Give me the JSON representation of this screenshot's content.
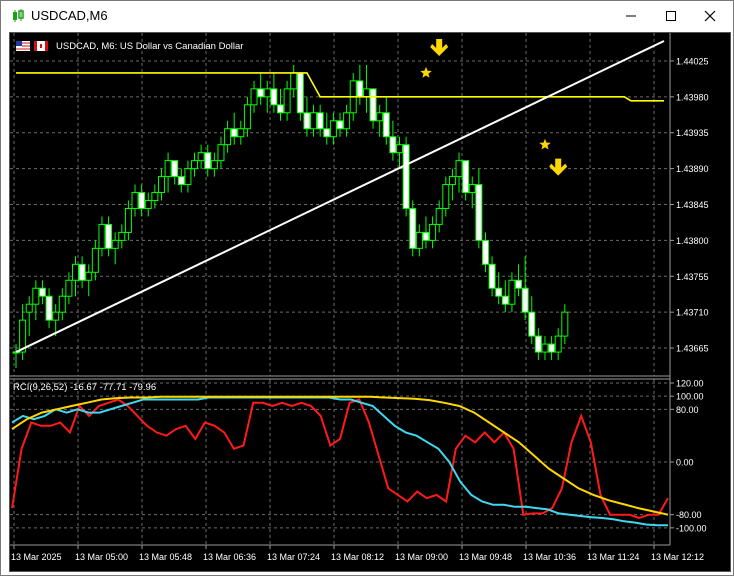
{
  "window": {
    "title": "USDCAD,M6",
    "minimize_icon": "minimize-icon",
    "maximize_icon": "maximize-icon",
    "close_icon": "close-icon"
  },
  "chart": {
    "header_text": "USDCAD, M6:  US Dollar vs Canadian Dollar",
    "indicator_text": "RCI(9,26,52) -16.67 -77.71 -79.96",
    "colors": {
      "background": "#000000",
      "grid": "#6b6b6b",
      "candle": "#00ff00",
      "candle_body_up": "#000000",
      "candle_body_down": "#ffffff",
      "ma_line": "#ffff00",
      "trend_line": "#ffffff",
      "marker": "#ffd700",
      "rci_fast": "#ff1a1a",
      "rci_mid": "#40d8f0",
      "rci_slow": "#ffd700",
      "axis_text": "#ffffff"
    },
    "price_ticks": [
      "1.44025",
      "1.43980",
      "1.43935",
      "1.43890",
      "1.43845",
      "1.43800",
      "1.43755",
      "1.43710",
      "1.43665"
    ],
    "rci_ticks": [
      "120.00",
      "100.00",
      "80.00",
      "0.00",
      "-80.00",
      "-100.00"
    ],
    "time_ticks": [
      "13 Mar 2025",
      "13 Mar 05:00",
      "13 Mar 05:48",
      "13 Mar 06:36",
      "13 Mar 07:24",
      "13 Mar 08:12",
      "13 Mar 09:00",
      "13 Mar 09:48",
      "13 Mar 10:36",
      "13 Mar 11:24",
      "13 Mar 12:12"
    ]
  },
  "chart_data": {
    "type": "candlestick",
    "symbol": "USDCAD",
    "timeframe": "M6",
    "price_range": [
      1.4364,
      1.4405
    ],
    "candles": [
      [
        1.4366,
        1.4367,
        1.4364,
        1.4366
      ],
      [
        1.4366,
        1.4372,
        1.4365,
        1.437
      ],
      [
        1.4371,
        1.4373,
        1.4368,
        1.4372
      ],
      [
        1.4372,
        1.4375,
        1.437,
        1.4374
      ],
      [
        1.4374,
        1.4375,
        1.4372,
        1.4373
      ],
      [
        1.4373,
        1.4374,
        1.4369,
        1.437
      ],
      [
        1.437,
        1.4372,
        1.4368,
        1.4371
      ],
      [
        1.4371,
        1.4374,
        1.437,
        1.4373
      ],
      [
        1.4373,
        1.4376,
        1.4372,
        1.4375
      ],
      [
        1.4375,
        1.4378,
        1.4373,
        1.4377
      ],
      [
        1.4377,
        1.4378,
        1.4374,
        1.4375
      ],
      [
        1.4375,
        1.4377,
        1.4373,
        1.4376
      ],
      [
        1.4376,
        1.438,
        1.4375,
        1.4379
      ],
      [
        1.4379,
        1.4383,
        1.4378,
        1.4382
      ],
      [
        1.4382,
        1.4383,
        1.4378,
        1.4379
      ],
      [
        1.4379,
        1.4381,
        1.4377,
        1.438
      ],
      [
        1.438,
        1.4382,
        1.4379,
        1.4381
      ],
      [
        1.4381,
        1.4385,
        1.438,
        1.4384
      ],
      [
        1.4384,
        1.4387,
        1.4383,
        1.4386
      ],
      [
        1.4386,
        1.4387,
        1.4383,
        1.4384
      ],
      [
        1.4384,
        1.4386,
        1.4383,
        1.4385
      ],
      [
        1.4385,
        1.4387,
        1.4384,
        1.4386
      ],
      [
        1.4386,
        1.4389,
        1.4385,
        1.4388
      ],
      [
        1.4388,
        1.4391,
        1.4386,
        1.439
      ],
      [
        1.439,
        1.439,
        1.4387,
        1.4388
      ],
      [
        1.4388,
        1.4389,
        1.4386,
        1.4387
      ],
      [
        1.4387,
        1.439,
        1.4386,
        1.4389
      ],
      [
        1.4389,
        1.4391,
        1.4388,
        1.439
      ],
      [
        1.439,
        1.4392,
        1.4389,
        1.4391
      ],
      [
        1.4391,
        1.4392,
        1.4388,
        1.4389
      ],
      [
        1.4389,
        1.4391,
        1.4388,
        1.439
      ],
      [
        1.439,
        1.4393,
        1.4389,
        1.4392
      ],
      [
        1.4392,
        1.4395,
        1.4391,
        1.4394
      ],
      [
        1.4394,
        1.4396,
        1.4392,
        1.4393
      ],
      [
        1.4393,
        1.4395,
        1.4392,
        1.4394
      ],
      [
        1.4394,
        1.4398,
        1.4393,
        1.4397
      ],
      [
        1.4397,
        1.44,
        1.4396,
        1.4399
      ],
      [
        1.4399,
        1.4401,
        1.4397,
        1.4398
      ],
      [
        1.4398,
        1.44,
        1.4396,
        1.4399
      ],
      [
        1.4399,
        1.4401,
        1.4396,
        1.4397
      ],
      [
        1.4397,
        1.4399,
        1.4395,
        1.4396
      ],
      [
        1.4396,
        1.44,
        1.4395,
        1.4399
      ],
      [
        1.4399,
        1.4402,
        1.4398,
        1.4401
      ],
      [
        1.4401,
        1.4401,
        1.4395,
        1.4396
      ],
      [
        1.4396,
        1.4398,
        1.4393,
        1.4394
      ],
      [
        1.4394,
        1.4397,
        1.4393,
        1.4396
      ],
      [
        1.4396,
        1.4397,
        1.4393,
        1.4394
      ],
      [
        1.4394,
        1.4396,
        1.4392,
        1.4393
      ],
      [
        1.4393,
        1.4396,
        1.4392,
        1.4395
      ],
      [
        1.4395,
        1.4396,
        1.4393,
        1.4394
      ],
      [
        1.4394,
        1.4397,
        1.4393,
        1.4396
      ],
      [
        1.4396,
        1.4401,
        1.4395,
        1.44
      ],
      [
        1.44,
        1.4402,
        1.4397,
        1.4398
      ],
      [
        1.4398,
        1.4402,
        1.4396,
        1.4399
      ],
      [
        1.4399,
        1.4399,
        1.4394,
        1.4395
      ],
      [
        1.4395,
        1.4397,
        1.4393,
        1.4396
      ],
      [
        1.4396,
        1.4398,
        1.4392,
        1.4393
      ],
      [
        1.4393,
        1.4395,
        1.439,
        1.4391
      ],
      [
        1.4391,
        1.4393,
        1.4389,
        1.4392
      ],
      [
        1.4392,
        1.4393,
        1.4383,
        1.4384
      ],
      [
        1.4384,
        1.4385,
        1.4378,
        1.4379
      ],
      [
        1.4379,
        1.4382,
        1.4378,
        1.4381
      ],
      [
        1.4381,
        1.4383,
        1.4379,
        1.438
      ],
      [
        1.438,
        1.4383,
        1.4379,
        1.4382
      ],
      [
        1.4382,
        1.4385,
        1.4381,
        1.4384
      ],
      [
        1.4384,
        1.4388,
        1.4383,
        1.4387
      ],
      [
        1.4387,
        1.4389,
        1.4385,
        1.4388
      ],
      [
        1.4388,
        1.4391,
        1.4386,
        1.439
      ],
      [
        1.439,
        1.439,
        1.4385,
        1.4386
      ],
      [
        1.4386,
        1.4388,
        1.4384,
        1.4387
      ],
      [
        1.4387,
        1.4389,
        1.4379,
        1.438
      ],
      [
        1.438,
        1.4381,
        1.4376,
        1.4377
      ],
      [
        1.4377,
        1.4378,
        1.4373,
        1.4374
      ],
      [
        1.4374,
        1.4376,
        1.4372,
        1.4373
      ],
      [
        1.4373,
        1.4375,
        1.4371,
        1.4372
      ],
      [
        1.4372,
        1.4376,
        1.4371,
        1.4375
      ],
      [
        1.4375,
        1.4377,
        1.4373,
        1.4374
      ],
      [
        1.4374,
        1.4378,
        1.437,
        1.4371
      ],
      [
        1.4371,
        1.4373,
        1.4367,
        1.4368
      ],
      [
        1.4368,
        1.4369,
        1.4365,
        1.4366
      ],
      [
        1.4366,
        1.4368,
        1.4365,
        1.4367
      ],
      [
        1.4367,
        1.4368,
        1.4365,
        1.4366
      ],
      [
        1.4366,
        1.4369,
        1.4365,
        1.4368
      ],
      [
        1.4368,
        1.4372,
        1.4367,
        1.4371
      ]
    ],
    "ma_line": [
      [
        0,
        1.4401
      ],
      [
        44,
        1.4401
      ],
      [
        46,
        1.4398
      ],
      [
        92,
        1.4398
      ],
      [
        93,
        1.43975
      ],
      [
        98,
        1.43975
      ]
    ],
    "trend_line": [
      [
        0,
        1.4366
      ],
      [
        98,
        1.4405
      ]
    ],
    "markers": [
      {
        "type": "star",
        "bar": 62,
        "price": 1.4401
      },
      {
        "type": "arrow-down",
        "bar": 64,
        "price": 1.4404
      },
      {
        "type": "star",
        "bar": 80,
        "price": 1.4392
      },
      {
        "type": "arrow-down",
        "bar": 82,
        "price": 1.4389
      }
    ],
    "rci": {
      "name": "RCI(9,26,52)",
      "ylim": [
        -120,
        120
      ],
      "fast": [
        -70,
        20,
        60,
        55,
        55,
        60,
        45,
        85,
        70,
        85,
        90,
        95,
        85,
        70,
        55,
        45,
        40,
        50,
        55,
        35,
        60,
        55,
        45,
        20,
        25,
        90,
        90,
        85,
        90,
        85,
        90,
        85,
        70,
        25,
        35,
        90,
        95,
        60,
        10,
        -40,
        -50,
        -60,
        -45,
        -55,
        -50,
        -60,
        20,
        40,
        30,
        45,
        30,
        45,
        20,
        -80,
        -78,
        -78,
        -70,
        -40,
        30,
        70,
        30,
        -50,
        -80,
        -80,
        -80,
        -85,
        -80,
        -80,
        -55
      ],
      "mid": [
        60,
        70,
        65,
        70,
        80,
        75,
        80,
        75,
        75,
        80,
        85,
        90,
        95,
        95,
        95,
        95,
        95,
        95,
        98,
        98,
        98,
        98,
        98,
        98,
        98,
        98,
        98,
        98,
        98,
        98,
        95,
        95,
        90,
        85,
        70,
        55,
        45,
        40,
        30,
        20,
        0,
        -30,
        -50,
        -60,
        -65,
        -65,
        -68,
        -68,
        -70,
        -72,
        -78,
        -80,
        -82,
        -84,
        -85,
        -87,
        -90,
        -92,
        -95,
        -96,
        -96
      ],
      "slow": [
        50,
        65,
        75,
        80,
        85,
        90,
        95,
        97,
        98,
        98,
        99,
        99,
        99,
        99,
        99,
        99,
        99,
        99,
        99,
        99,
        99,
        99,
        99,
        99,
        99,
        98,
        97,
        96,
        94,
        90,
        85,
        75,
        60,
        45,
        30,
        10,
        -10,
        -25,
        -40,
        -50,
        -58,
        -64,
        -70,
        -75,
        -80
      ]
    }
  }
}
